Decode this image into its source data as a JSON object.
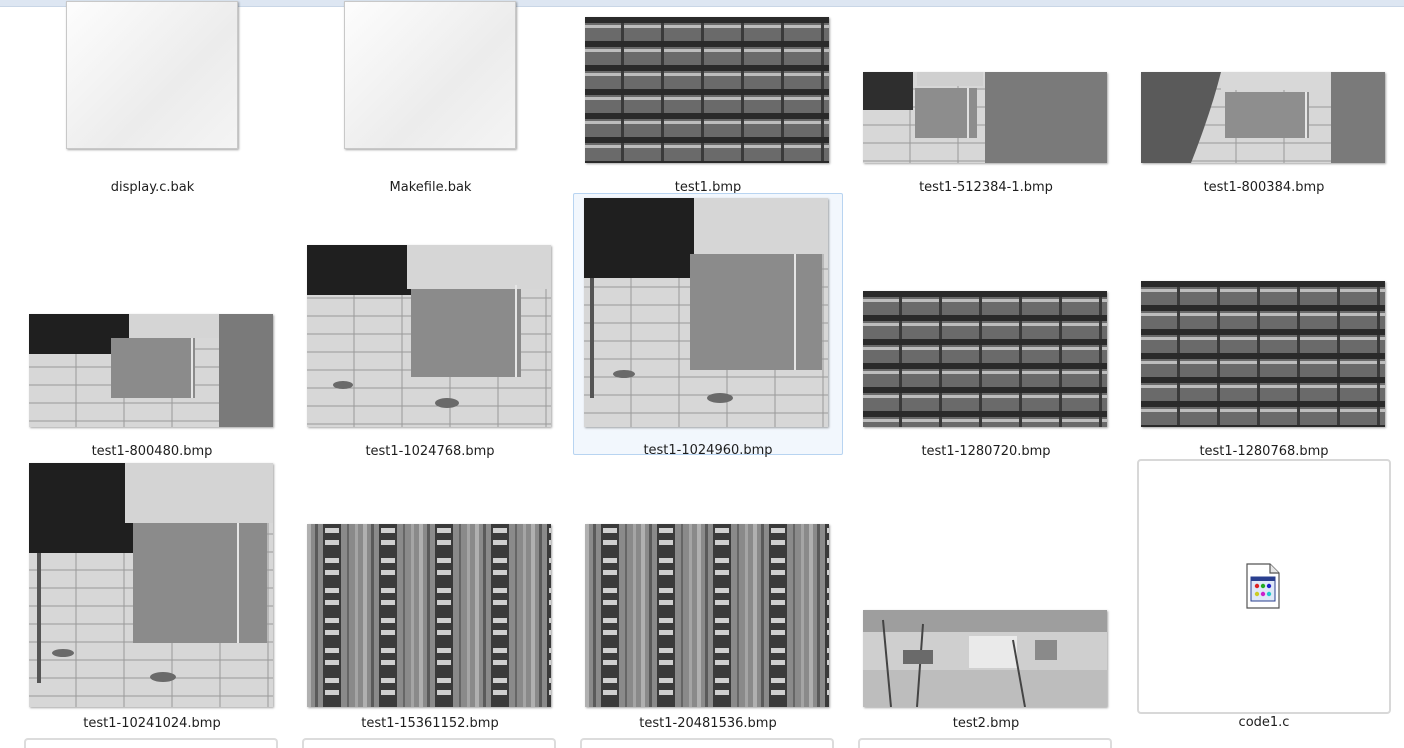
{
  "files": [
    {
      "name": "display.c.bak"
    },
    {
      "name": "Makefile.bak"
    },
    {
      "name": "test1.bmp"
    },
    {
      "name": "test1-512384-1.bmp"
    },
    {
      "name": "test1-800384.bmp"
    },
    {
      "name": "test1-800480.bmp"
    },
    {
      "name": "test1-1024768.bmp"
    },
    {
      "name": "test1-1024960.bmp"
    },
    {
      "name": "test1-1280720.bmp"
    },
    {
      "name": "test1-1280768.bmp"
    },
    {
      "name": "test1-10241024.bmp"
    },
    {
      "name": "test1-15361152.bmp"
    },
    {
      "name": "test1-20481536.bmp"
    },
    {
      "name": "test2.bmp"
    },
    {
      "name": "code1.c"
    }
  ],
  "selected_file": "test1-1024960.bmp",
  "colors": {
    "selection_bg": "#f2f7fd",
    "selection_border": "#b8d4f1"
  },
  "icons": {
    "bak_file": "blank-document-icon",
    "c_source_file": "c-source-file-icon"
  }
}
